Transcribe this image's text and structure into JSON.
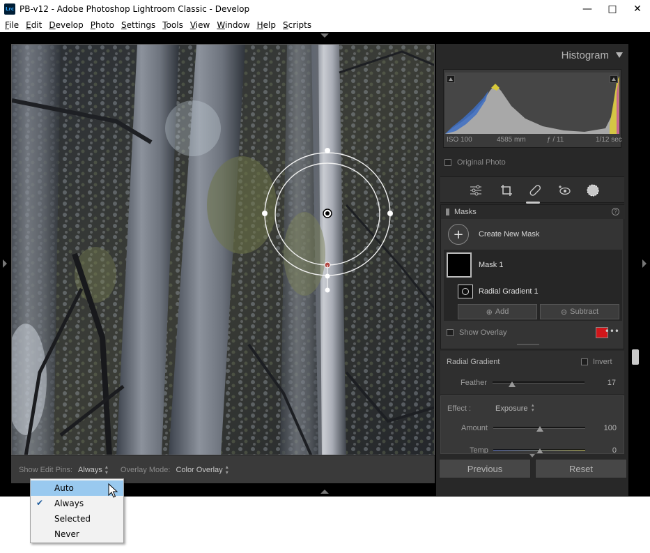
{
  "window": {
    "app_icon": "Lrc",
    "title": "PB-v12 - Adobe Photoshop Lightroom Classic - Develop",
    "minimize_icon": "minimize-icon",
    "maximize_icon": "maximize-icon",
    "close_icon": "close-icon"
  },
  "menu": [
    "File",
    "Edit",
    "Develop",
    "Photo",
    "Settings",
    "Tools",
    "View",
    "Window",
    "Help",
    "Scripts"
  ],
  "histogram": {
    "title": "Histogram",
    "iso": "ISO 100",
    "focal": "4585 mm",
    "aperture": "ƒ / 11",
    "shutter": "1/12 sec",
    "original_photo": "Original Photo"
  },
  "tools": [
    "sliders-icon",
    "crop-icon",
    "healing-icon",
    "redeye-icon",
    "masking-icon"
  ],
  "masks": {
    "title": "Masks",
    "help": "?",
    "create_new": "Create New Mask",
    "mask_name": "Mask 1",
    "component_name": "Radial Gradient 1",
    "add": "Add",
    "subtract": "Subtract",
    "show_overlay": "Show Overlay",
    "overlay_color": "#d0161a"
  },
  "radial": {
    "title": "Radial Gradient",
    "invert": "Invert",
    "feather_label": "Feather",
    "feather_value": "17",
    "feather_level": 0.17
  },
  "effect": {
    "label": "Effect :",
    "value": "Exposure",
    "amount_label": "Amount",
    "amount_value": "100",
    "amount_level": 0.5,
    "temp_label": "Temp",
    "temp_value": "0",
    "temp_level": 0.5
  },
  "buttons": {
    "previous": "Previous",
    "reset": "Reset"
  },
  "toolbar": {
    "edit_pins_label": "Show Edit Pins:",
    "edit_pins_value": "Always",
    "overlay_mode_label": "Overlay Mode:",
    "overlay_mode_value": "Color Overlay"
  },
  "dropdown": {
    "items": [
      "Auto",
      "Always",
      "Selected",
      "Never"
    ],
    "highlighted": "Auto",
    "checked": "Always"
  }
}
